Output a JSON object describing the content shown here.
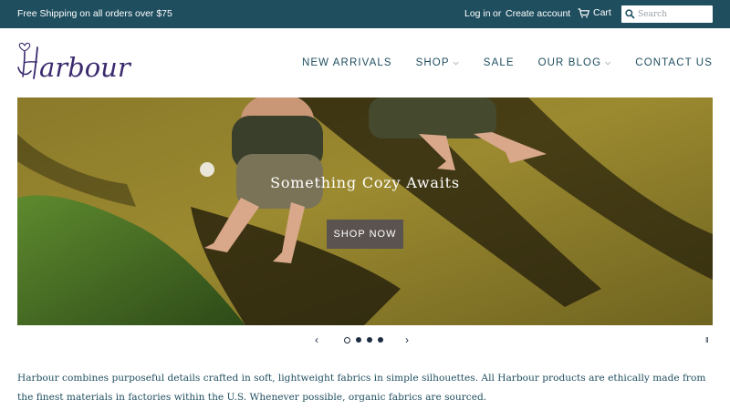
{
  "topbar": {
    "promo": "Free Shipping on all orders over $75",
    "login": "Log in",
    "or": "or",
    "create_account": "Create account",
    "cart": "Cart",
    "search_placeholder": "Search"
  },
  "header": {
    "logo_text": "Harbour",
    "nav": [
      {
        "label": "NEW ARRIVALS",
        "has_dropdown": false
      },
      {
        "label": "SHOP",
        "has_dropdown": true
      },
      {
        "label": "SALE",
        "has_dropdown": false
      },
      {
        "label": "OUR BLOG",
        "has_dropdown": true
      },
      {
        "label": "CONTACT US",
        "has_dropdown": false
      }
    ]
  },
  "hero": {
    "title": "Something Cozy Awaits",
    "button": "SHOP NOW"
  },
  "slider": {
    "prev": "‹",
    "next": "›",
    "slide_count": 4,
    "active_slide": 1,
    "pause": "II"
  },
  "intro": {
    "text": "Harbour combines purposeful details crafted in soft, lightweight fabrics in simple silhouettes. All Harbour products are ethically made from the finest materials in factories within the U.S.  Whenever possible, organic fabrics are sourced."
  },
  "colors": {
    "topbar_bg": "#1f4e5f",
    "nav_text": "#1f4e5f",
    "logo": "#3b2a6e",
    "button_bg": "#5a5350"
  }
}
